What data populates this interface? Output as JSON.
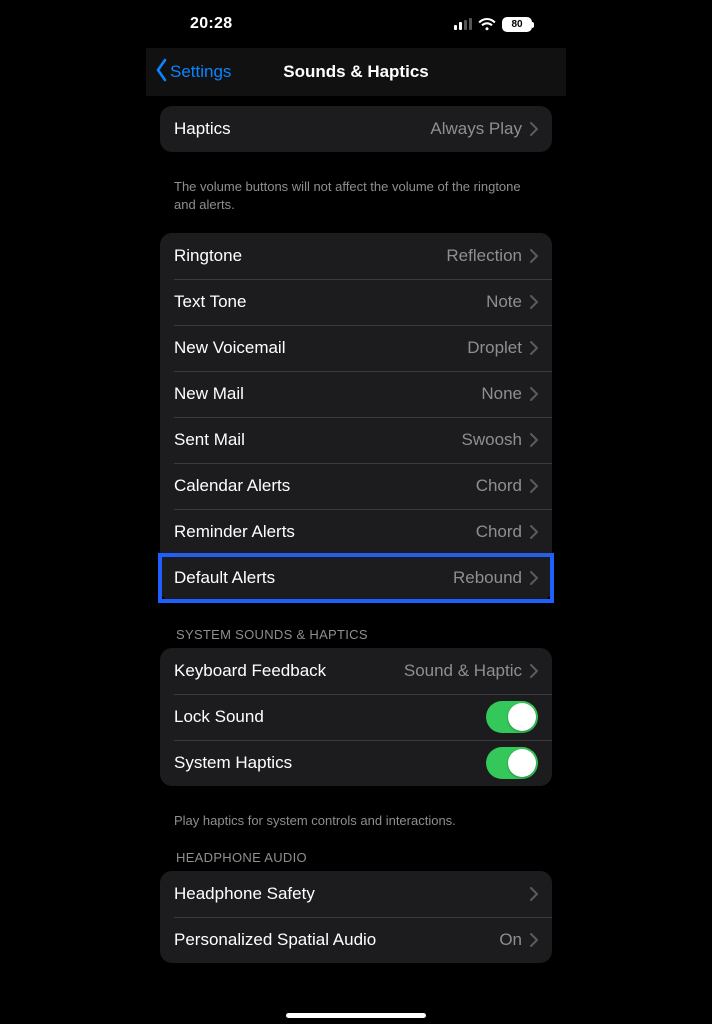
{
  "status": {
    "time": "20:28",
    "battery": "80"
  },
  "nav": {
    "back_label": "Settings",
    "title": "Sounds & Haptics"
  },
  "group0": {
    "haptics_label": "Haptics",
    "haptics_value": "Always Play",
    "footer": "The volume buttons will not affect the volume of the ringtone and alerts."
  },
  "sounds": {
    "ringtone_label": "Ringtone",
    "ringtone_value": "Reflection",
    "text_tone_label": "Text Tone",
    "text_tone_value": "Note",
    "new_voicemail_label": "New Voicemail",
    "new_voicemail_value": "Droplet",
    "new_mail_label": "New Mail",
    "new_mail_value": "None",
    "sent_mail_label": "Sent Mail",
    "sent_mail_value": "Swoosh",
    "calendar_alerts_label": "Calendar Alerts",
    "calendar_alerts_value": "Chord",
    "reminder_alerts_label": "Reminder Alerts",
    "reminder_alerts_value": "Chord",
    "default_alerts_label": "Default Alerts",
    "default_alerts_value": "Rebound"
  },
  "system": {
    "header": "System Sounds & Haptics",
    "keyboard_feedback_label": "Keyboard Feedback",
    "keyboard_feedback_value": "Sound & Haptic",
    "lock_sound_label": "Lock Sound",
    "system_haptics_label": "System Haptics",
    "footer": "Play haptics for system controls and interactions."
  },
  "headphone": {
    "header": "Headphone Audio",
    "safety_label": "Headphone Safety",
    "spatial_label": "Personalized Spatial Audio",
    "spatial_value": "On"
  }
}
